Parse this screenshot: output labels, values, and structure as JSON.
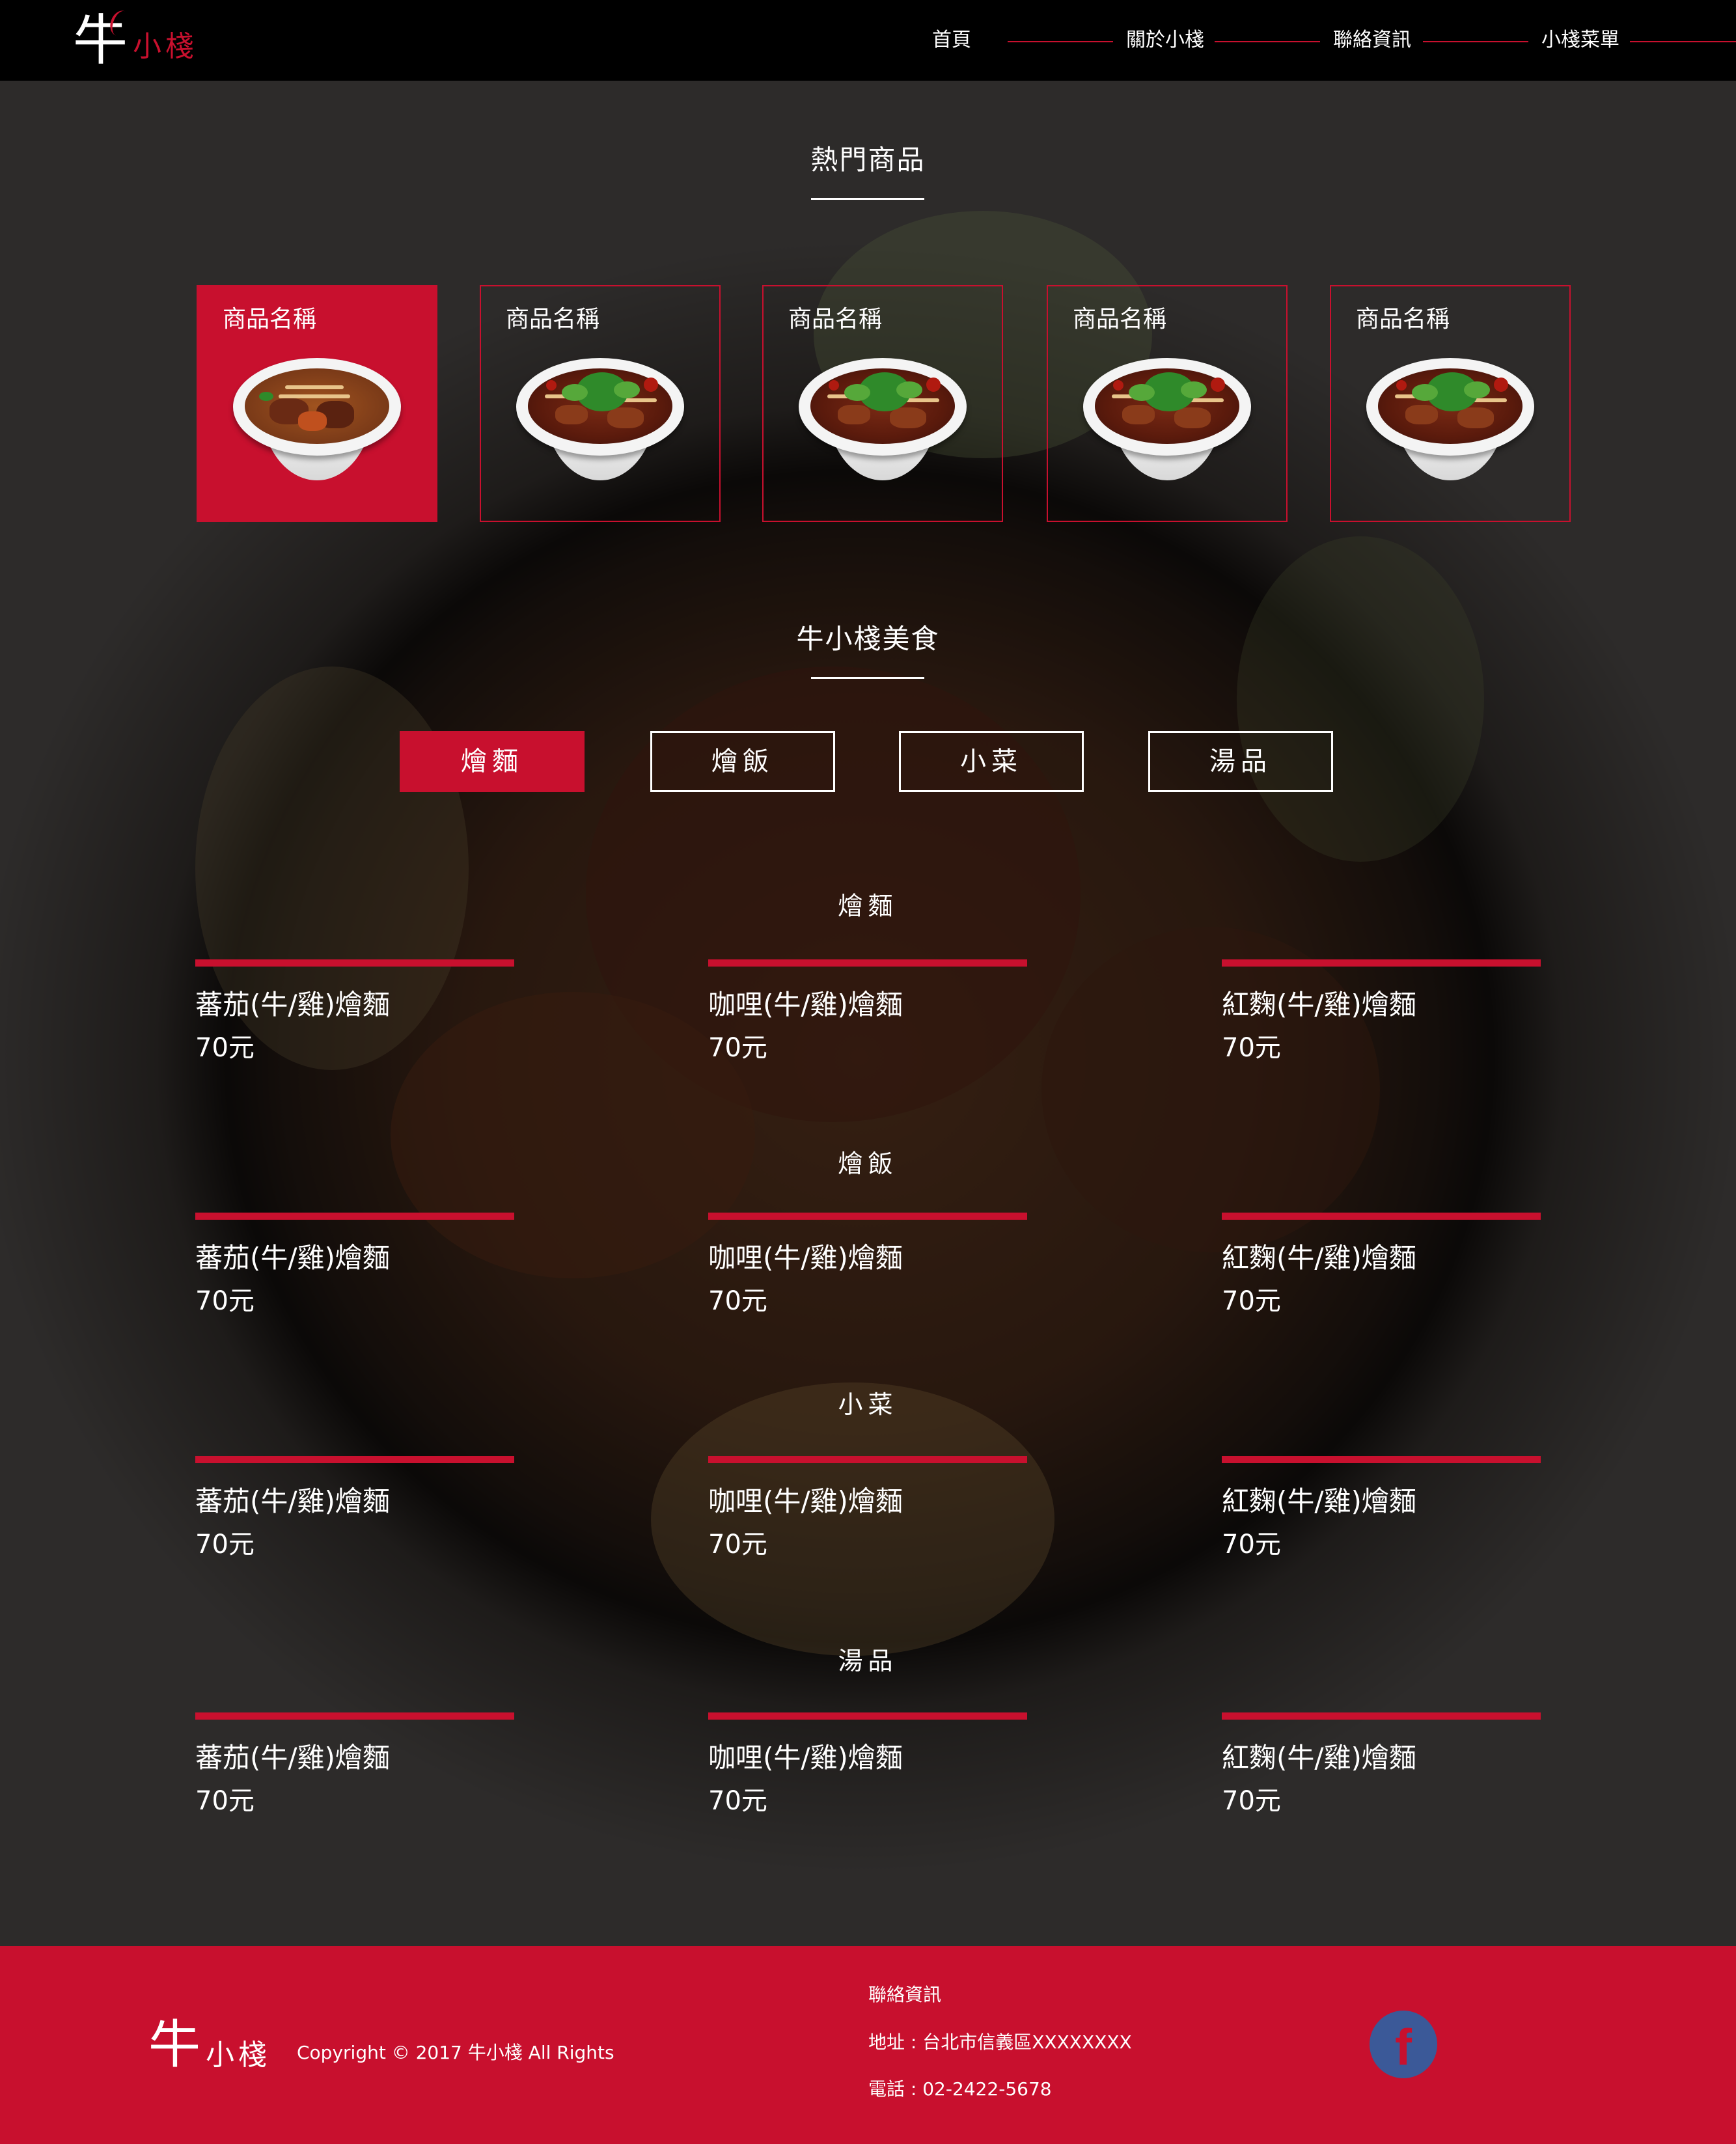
{
  "brand": {
    "logo_main": "牛",
    "logo_sub": "小棧"
  },
  "nav": {
    "items": [
      {
        "label": "首頁"
      },
      {
        "label": "關於小棧"
      },
      {
        "label": "聯絡資訊"
      },
      {
        "label": "小棧菜單"
      }
    ]
  },
  "hot": {
    "title": "熱門商品",
    "products": [
      {
        "name": "商品名稱",
        "active": true
      },
      {
        "name": "商品名稱",
        "active": false
      },
      {
        "name": "商品名稱",
        "active": false
      },
      {
        "name": "商品名稱",
        "active": false
      },
      {
        "name": "商品名稱",
        "active": false
      }
    ]
  },
  "food": {
    "title": "牛小棧美食",
    "tabs": [
      {
        "label": "燴麵",
        "active": true
      },
      {
        "label": "燴飯",
        "active": false
      },
      {
        "label": "小菜",
        "active": false
      },
      {
        "label": "湯品",
        "active": false
      }
    ]
  },
  "menu": {
    "sections": [
      {
        "title": "燴麵",
        "items": [
          {
            "name": "蕃茄(牛/雞)燴麵",
            "price": "70元"
          },
          {
            "name": "咖哩(牛/雞)燴麵",
            "price": "70元"
          },
          {
            "name": "紅麴(牛/雞)燴麵",
            "price": "70元"
          }
        ]
      },
      {
        "title": "燴飯",
        "items": [
          {
            "name": "蕃茄(牛/雞)燴麵",
            "price": "70元"
          },
          {
            "name": "咖哩(牛/雞)燴麵",
            "price": "70元"
          },
          {
            "name": "紅麴(牛/雞)燴麵",
            "price": "70元"
          }
        ]
      },
      {
        "title": "小菜",
        "items": [
          {
            "name": "蕃茄(牛/雞)燴麵",
            "price": "70元"
          },
          {
            "name": "咖哩(牛/雞)燴麵",
            "price": "70元"
          },
          {
            "name": "紅麴(牛/雞)燴麵",
            "price": "70元"
          }
        ]
      },
      {
        "title": "湯品",
        "items": [
          {
            "name": "蕃茄(牛/雞)燴麵",
            "price": "70元"
          },
          {
            "name": "咖哩(牛/雞)燴麵",
            "price": "70元"
          },
          {
            "name": "紅麴(牛/雞)燴麵",
            "price": "70元"
          }
        ]
      }
    ]
  },
  "footer": {
    "copyright": "Copyright © 2017 牛小棧 All Rights",
    "contact_title": "聯絡資訊",
    "address": "地址 : 台北市信義區XXXXXXXX",
    "phone": "電話 : 02-2422-5678",
    "social_icon": "facebook-icon",
    "social_glyph": "f"
  },
  "colors": {
    "accent": "#c8102e",
    "header_bg": "#000000",
    "facebook": "#3b5998"
  }
}
